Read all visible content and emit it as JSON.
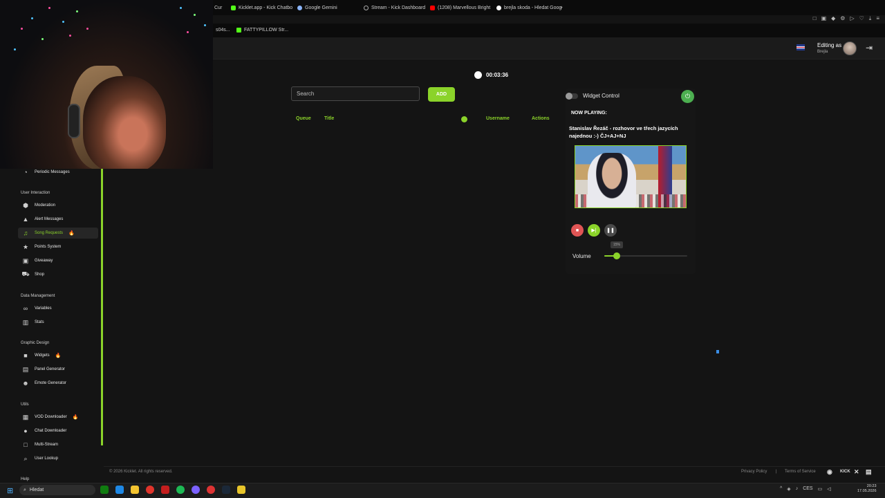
{
  "browser": {
    "tabs": [
      {
        "label": "Cur",
        "icon": "kick-icon",
        "color": "#53fc18"
      },
      {
        "label": "Kicklet.app - Kick Chatbo",
        "icon": "kicklet-icon",
        "color": "#53fc18"
      },
      {
        "label": "Google Gemini",
        "icon": "gemini-icon",
        "color": "#8ab4f8"
      },
      {
        "label": "Stream - Kick Dashboard",
        "icon": "loading-icon",
        "color": "#aaaaaa"
      },
      {
        "label": "(1208) Marvellous Bright",
        "icon": "youtube-icon",
        "color": "#ff0000"
      },
      {
        "label": "brejla skoda - Hledat Goog",
        "icon": "google-icon",
        "color": "#ffffff"
      }
    ],
    "new_tab": "+",
    "bookmarks": [
      {
        "label": "s04s..."
      },
      {
        "label": "FATTYPILLOW Str..."
      }
    ]
  },
  "header": {
    "editing_as": "Editing as",
    "user": "Brejla"
  },
  "sidebar": {
    "top_item": {
      "label": "Periodic Messages",
      "icon": "clock-icon"
    },
    "categories": [
      {
        "label": "User Interaction",
        "items": [
          {
            "label": "Moderation",
            "icon": "shield-icon"
          },
          {
            "label": "Alert Messages",
            "icon": "warning-icon"
          },
          {
            "label": "Song Requests",
            "icon": "music-icon",
            "active": true,
            "badge": "fire"
          },
          {
            "label": "Points System",
            "icon": "star-icon"
          },
          {
            "label": "Giveaway",
            "icon": "gift-icon"
          },
          {
            "label": "Shop",
            "icon": "cart-icon"
          }
        ]
      },
      {
        "label": "Data Management",
        "items": [
          {
            "label": "Variables",
            "icon": "link-icon"
          },
          {
            "label": "Stats",
            "icon": "stats-icon"
          }
        ]
      },
      {
        "label": "Graphic Design",
        "items": [
          {
            "label": "Widgets",
            "icon": "video-icon",
            "badge": "fire"
          },
          {
            "label": "Panel Generator",
            "icon": "panel-icon"
          },
          {
            "label": "Emote Generator",
            "icon": "emote-icon"
          }
        ]
      },
      {
        "label": "Utils",
        "items": [
          {
            "label": "VOD Downloader",
            "icon": "film-icon",
            "badge": "fire"
          },
          {
            "label": "Chat Downloader",
            "icon": "chat-icon"
          },
          {
            "label": "Multi-Stream",
            "icon": "window-icon"
          },
          {
            "label": "User Lookup",
            "icon": "search-icon"
          }
        ]
      }
    ],
    "bottom_label": "Help"
  },
  "main": {
    "timer": "00:03:36",
    "search": {
      "placeholder": "Search",
      "value": ""
    },
    "add_label": "ADD",
    "columns": {
      "queue": "Queue",
      "title": "Title",
      "username": "Username",
      "actions": "Actions"
    }
  },
  "widget": {
    "label": "Widget Control",
    "now_playing_label": "NOW PLAYING:",
    "song_title": "Stanislav Řezáč - rozhovor ve třech jazycích najednou :-) ČJ+AJ+NJ",
    "volume_label": "Volume",
    "volume_percent": 15,
    "volume_tip": "15%",
    "colors": {
      "accent": "#8bd32a",
      "stop": "#e05555",
      "power": "#4caf50"
    }
  },
  "footer": {
    "copyright": "© 2026 Kicklet. All rights reserved.",
    "privacy": "Privacy Policy",
    "separator": "|",
    "terms": "Terms of Service",
    "social": [
      "discord-icon",
      "kick-icon",
      "x-icon",
      "docs-icon"
    ],
    "kick_short": "KICK"
  },
  "taskbar": {
    "search_placeholder": "Hledat",
    "tray_lang": "CES",
    "time": "20:23",
    "date": "17.05.2026"
  }
}
